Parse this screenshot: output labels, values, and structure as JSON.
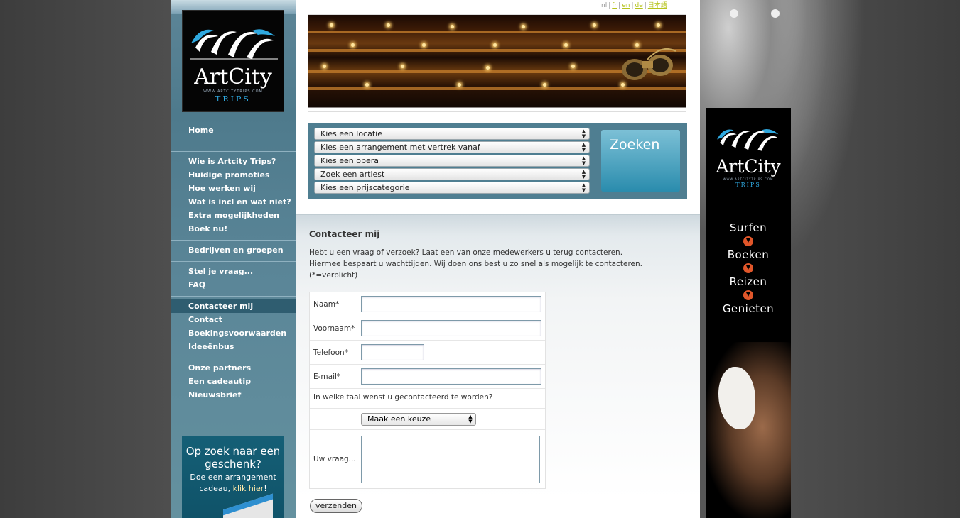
{
  "languages": [
    "nl",
    "fr",
    "en",
    "de",
    "日本語"
  ],
  "logo": {
    "art": "ArtCity",
    "url": "WWW.ARTCITYTRIPS.COM",
    "trips": "TRIPS"
  },
  "nav": {
    "home": "Home",
    "group1": [
      "Wie is Artcity Trips?",
      "Huidige promoties",
      "Hoe werken wij",
      "Wat is incl en wat niet?",
      "Extra mogelijkheden",
      "Boek nu!"
    ],
    "group2": [
      "Bedrijven en groepen"
    ],
    "group3": [
      "Stel je vraag...",
      "FAQ"
    ],
    "group4": [
      "Contacteer mij",
      "Contact",
      "Boekingsvoorwaarden",
      "Ideeënbus"
    ],
    "group5": [
      "Onze partners",
      "Een cadeautip",
      "Nieuwsbrief"
    ],
    "active": "Contacteer mij"
  },
  "gift": {
    "title": "Op zoek naar een geschenk?",
    "text": "Doe een arrangement cadeau,",
    "link": "klik hier",
    "tail": "!"
  },
  "search": {
    "selects": [
      "Kies een locatie",
      "Kies een arrangement met vertrek vanaf",
      "Kies een opera",
      "Zoek een artiest",
      "Kies een prijscategorie"
    ],
    "button": "Zoeken"
  },
  "contact": {
    "heading": "Contacteer mij",
    "intro1": "Hebt u een vraag of verzoek? Laat een van onze medewerkers u terug contacteren.",
    "intro2": "Hiermee bespaart u wachttijden. Wij doen ons best u zo snel als mogelijk te contacteren.",
    "intro3": "(*=verplicht)",
    "labels": {
      "naam": "Naam*",
      "voornaam": "Voornaam*",
      "telefoon": "Telefoon*",
      "email": "E-mail*",
      "taal_question": "In welke taal wenst u gecontacteerd te worden?",
      "vraag": "Uw vraag..."
    },
    "language_select": "Maak een keuze",
    "submit": "verzenden"
  },
  "ad": {
    "words": [
      "Surfen",
      "Boeken",
      "Reizen",
      "Genieten"
    ]
  },
  "colors": {
    "sidebar": "#4e7a8c",
    "search_panel": "#4f7e91",
    "accent_arrow": "#e0562a",
    "lang_link": "#b5c21a"
  }
}
